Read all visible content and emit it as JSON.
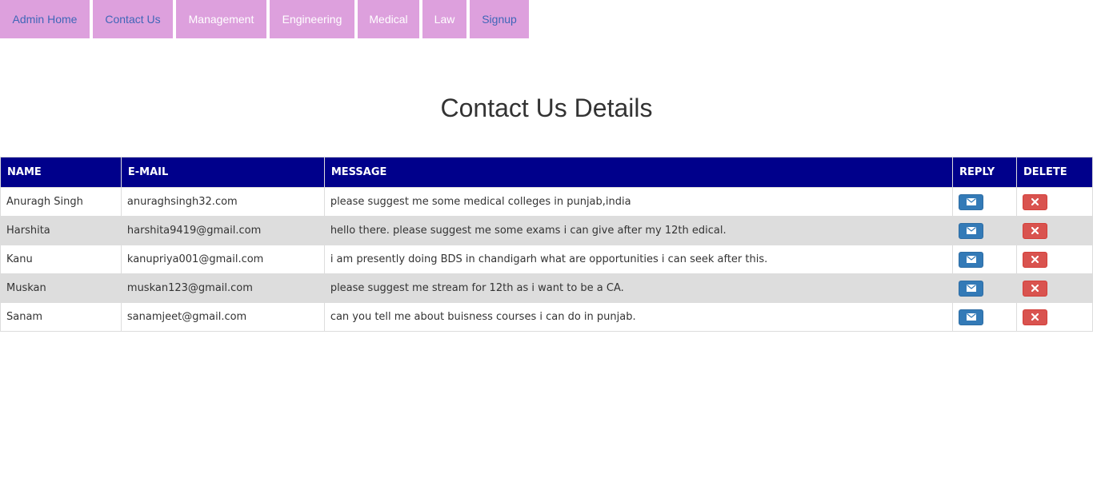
{
  "nav": {
    "items": [
      {
        "label": "Admin Home",
        "color": "#3f66b7"
      },
      {
        "label": "Contact Us",
        "color": "#3f66b7"
      },
      {
        "label": "Management",
        "color": "#ffffff"
      },
      {
        "label": "Engineering",
        "color": "#ffffff"
      },
      {
        "label": "Medical",
        "color": "#ffffff"
      },
      {
        "label": "Law",
        "color": "#ffffff"
      },
      {
        "label": "Signup",
        "color": "#3f66b7"
      }
    ],
    "background": "#dda0dd"
  },
  "page_title": "Contact Us Details",
  "table": {
    "headers": {
      "name": "NAME",
      "email": "E-MAIL",
      "message": "MESSAGE",
      "reply": "REPLY",
      "delete": "DELETE"
    },
    "header_color": "#00008b",
    "rows": [
      {
        "name": "Anuragh Singh",
        "email": "anuraghsingh32.com",
        "message": "please suggest me some medical colleges in punjab,india"
      },
      {
        "name": "Harshita",
        "email": "harshita9419@gmail.com",
        "message": "hello there. please suggest me some exams i can give after my 12th edical."
      },
      {
        "name": "Kanu",
        "email": "kanupriya001@gmail.com",
        "message": "i am presently doing BDS in chandigarh what are opportunities i can seek after this."
      },
      {
        "name": "Muskan",
        "email": "muskan123@gmail.com",
        "message": "please suggest me stream for 12th as i want to be a CA."
      },
      {
        "name": "Sanam",
        "email": "sanamjeet@gmail.com",
        "message": "can you tell me about buisness courses i can do in punjab."
      }
    ],
    "reply_icon": "envelope-icon",
    "delete_icon": "close-icon",
    "reply_color": "#337ab7",
    "delete_color": "#d9534f"
  }
}
